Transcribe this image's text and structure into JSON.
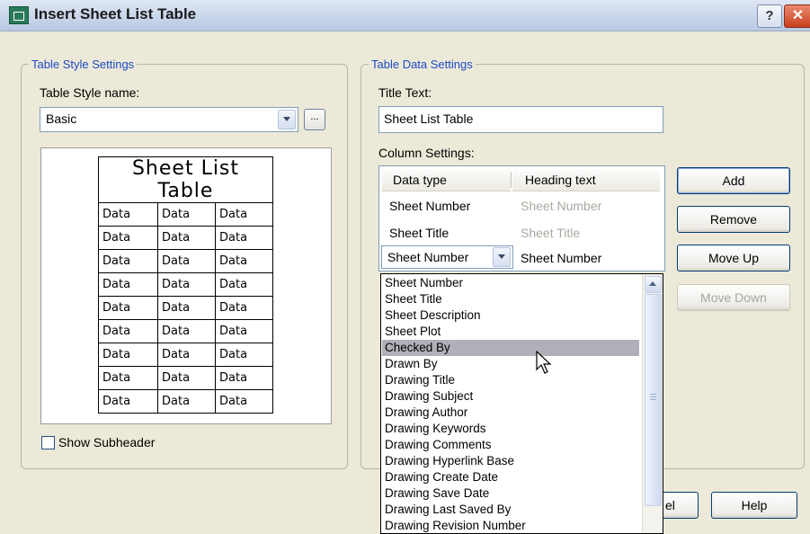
{
  "window": {
    "title": "Insert Sheet List Table",
    "help_glyph": "?",
    "close_glyph": "✕"
  },
  "style_settings": {
    "legend": "Table Style Settings",
    "style_name_label": "Table Style name:",
    "style_name_value": "Basic",
    "browse_label": "...",
    "preview": {
      "title": "Sheet  List  Table",
      "rows": [
        [
          "Data",
          "Data",
          "Data"
        ],
        [
          "Data",
          "Data",
          "Data"
        ],
        [
          "Data",
          "Data",
          "Data"
        ],
        [
          "Data",
          "Data",
          "Data"
        ],
        [
          "Data",
          "Data",
          "Data"
        ],
        [
          "Data",
          "Data",
          "Data"
        ],
        [
          "Data",
          "Data",
          "Data"
        ],
        [
          "Data",
          "Data",
          "Data"
        ],
        [
          "Data",
          "Data",
          "Data"
        ]
      ]
    },
    "show_subheader_label": "Show Subheader",
    "show_subheader_checked": false
  },
  "data_settings": {
    "legend": "Table Data Settings",
    "title_text_label": "Title Text:",
    "title_text_value": "Sheet List Table",
    "column_settings_label": "Column Settings:",
    "columns": {
      "col1": "Data type",
      "col2": "Heading text"
    },
    "rows": [
      {
        "type": "Sheet Number",
        "heading": "Sheet Number"
      },
      {
        "type": "Sheet Title",
        "heading": "Sheet Title"
      },
      {
        "type": "Sheet Number",
        "heading": "Sheet Number"
      }
    ]
  },
  "buttons": {
    "add": "Add",
    "remove": "Remove",
    "move_up": "Move Up",
    "move_down": "Move Down",
    "cancel_partial": "el",
    "help": "Help"
  },
  "dropdown": {
    "highlighted": "Checked By",
    "options": [
      "Sheet Number",
      "Sheet Title",
      "Sheet Description",
      "Sheet Plot",
      "Checked By",
      "Drawn By",
      "Drawing Title",
      "Drawing Subject",
      "Drawing Author",
      "Drawing Keywords",
      "Drawing Comments",
      "Drawing Hyperlink Base",
      "Drawing Create Date",
      "Drawing Save Date",
      "Drawing Last Saved By",
      "Drawing Revision Number"
    ]
  },
  "colors": {
    "legend_text": "#1c4bc6",
    "dialog_bg": "#ece9d8",
    "highlight": "#b0b0b8",
    "close_red": "#c9401f"
  }
}
